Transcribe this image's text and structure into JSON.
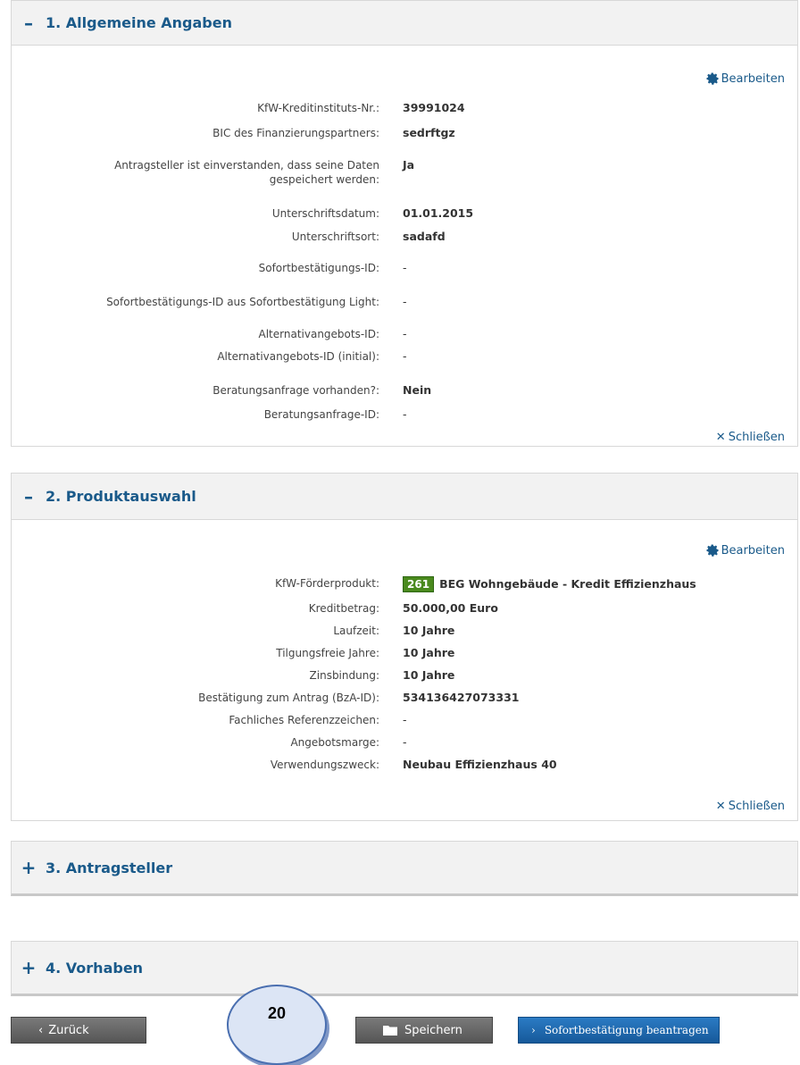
{
  "section1": {
    "toggle": "–",
    "title": "1. Allgemeine Angaben",
    "edit_label": "Bearbeiten",
    "close_label": "Schließen",
    "fields": [
      {
        "label": "KfW-Kreditinstituts-Nr.:",
        "value": "39991024"
      },
      {
        "label": "BIC des Finanzierungspartners:",
        "value": "sedrftgz"
      },
      {
        "label": "Antragsteller ist einverstanden, dass seine Daten gespeichert werden:",
        "value": "Ja"
      },
      {
        "label": "Unterschriftsdatum:",
        "value": "01.01.2015"
      },
      {
        "label": "Unterschriftsort:",
        "value": "sadafd"
      },
      {
        "label": "Sofortbestätigungs-ID:",
        "value": "-"
      },
      {
        "label": "Sofortbestätigungs-ID aus Sofortbestätigung Light:",
        "value": "-"
      },
      {
        "label": "Alternativangebots-ID:",
        "value": "-"
      },
      {
        "label": "Alternativangebots-ID (initial):",
        "value": "-"
      },
      {
        "label": "Beratungsanfrage vorhanden?:",
        "value": "Nein"
      },
      {
        "label": "Beratungsanfrage-ID:",
        "value": "-"
      }
    ]
  },
  "section2": {
    "toggle": "–",
    "title": "2. Produktauswahl",
    "edit_label": "Bearbeiten",
    "close_label": "Schließen",
    "product_badge": "261",
    "fields": [
      {
        "label": "KfW-Förderprodukt:",
        "value": "BEG Wohngebäude - Kredit Effizienzhaus"
      },
      {
        "label": "Kreditbetrag:",
        "value": "50.000,00 Euro"
      },
      {
        "label": "Laufzeit:",
        "value": "10 Jahre"
      },
      {
        "label": "Tilgungsfreie Jahre:",
        "value": "10 Jahre"
      },
      {
        "label": "Zinsbindung:",
        "value": "10 Jahre"
      },
      {
        "label": "Bestätigung zum Antrag (BzA-ID):",
        "value": "534136427073331"
      },
      {
        "label": "Fachliches Referenzzeichen:",
        "value": "-"
      },
      {
        "label": "Angebotsmarge:",
        "value": "-"
      },
      {
        "label": "Verwendungszweck:",
        "value": "Neubau Effizienzhaus 40"
      }
    ]
  },
  "section3": {
    "toggle": "+",
    "title": "3. Antragsteller"
  },
  "section4": {
    "toggle": "+",
    "title": "4. Vorhaben"
  },
  "footer": {
    "back_label": "Zurück",
    "save_label": "Speichern",
    "submit_label": "Sofortbestätigung beantragen",
    "callout_number": "20"
  },
  "colors": {
    "accent": "#1a5a8a",
    "badge": "#4a8a1e",
    "button_blue": "#16599a"
  }
}
